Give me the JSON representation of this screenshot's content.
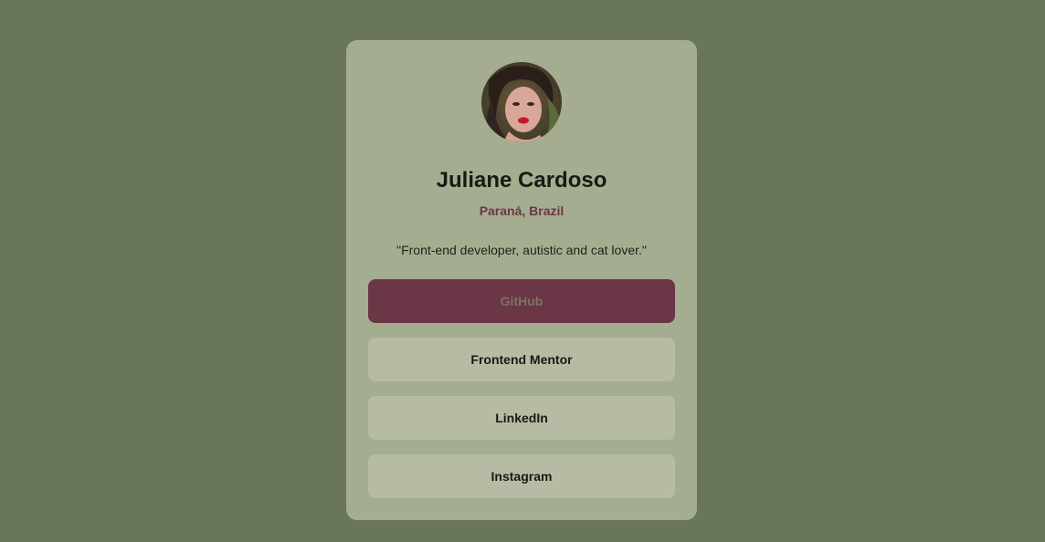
{
  "profile": {
    "avatar_alt": "avatar",
    "name": "Juliane Cardoso",
    "location": "Paraná, Brazil",
    "bio": "\"Front-end developer, autistic and cat lover.\""
  },
  "links": [
    {
      "label": "GitHub",
      "state": "hover"
    },
    {
      "label": "Frontend Mentor",
      "state": "default"
    },
    {
      "label": "LinkedIn",
      "state": "default"
    },
    {
      "label": "Instagram",
      "state": "default"
    }
  ],
  "colors": {
    "page_background": "#69765a",
    "card_background": "#a5ad91",
    "button_background": "#b6bca3",
    "accent": "#6b3646",
    "text": "#171a14"
  }
}
